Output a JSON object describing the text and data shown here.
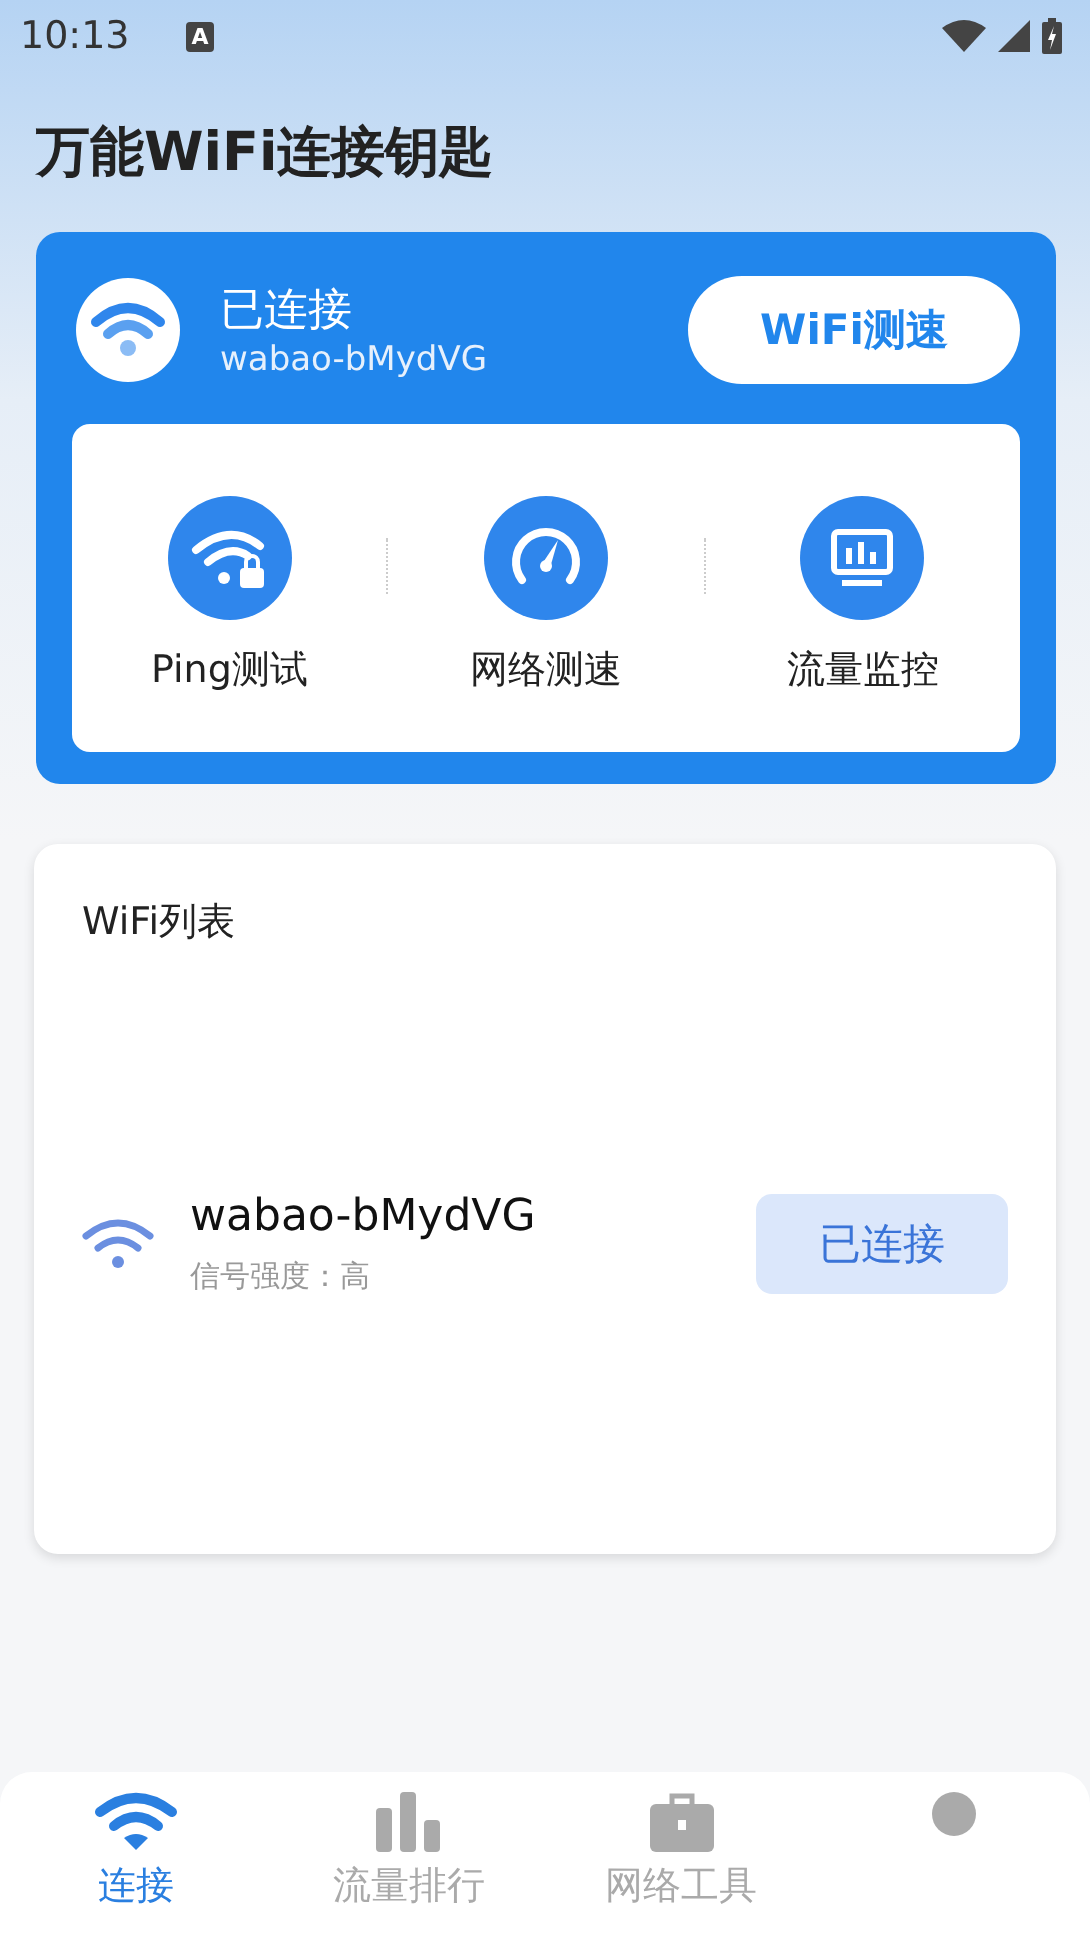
{
  "status_bar": {
    "time": "10:13",
    "badge": "A"
  },
  "app_title": "万能WiFi连接钥匙",
  "connection": {
    "status": "已连接",
    "ssid": "wabao-bMydVG",
    "button": "WiFi测速"
  },
  "tools": [
    {
      "kind": "ping",
      "label": "Ping测试"
    },
    {
      "kind": "speed",
      "label": "网络测速"
    },
    {
      "kind": "monitor",
      "label": "流量监控"
    }
  ],
  "wifi_list": {
    "title": "WiFi列表",
    "networks": [
      {
        "ssid": "wabao-bMydVG",
        "signal": "信号强度：高",
        "action": "已连接",
        "connected": true
      }
    ]
  },
  "bottom_nav": [
    {
      "kind": "wifi",
      "label": "连接",
      "selected": true
    },
    {
      "kind": "bars",
      "label": "流量排行",
      "selected": false
    },
    {
      "kind": "toolbox",
      "label": "网络工具",
      "selected": false
    },
    {
      "kind": "dot",
      "selected": false
    }
  ]
}
